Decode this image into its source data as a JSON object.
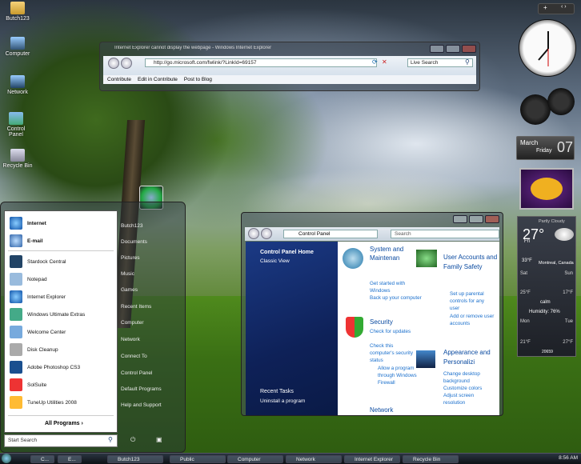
{
  "desktop_icons": [
    {
      "label": "Butch123"
    },
    {
      "label": "Computer"
    },
    {
      "label": "Network"
    },
    {
      "label": "Control Panel"
    },
    {
      "label": "Recycle Bin"
    }
  ],
  "ie": {
    "title": "Internet Explorer cannot display the webpage - Windows Internet Explorer",
    "address": "http://go.microsoft.com/fwlink/?LinkId=69157",
    "search_label": "Live Search",
    "toolbar": [
      "Contribute",
      "Edit in Contribute",
      "Post to Blog"
    ]
  },
  "start_menu": {
    "pinned": [
      "Internet",
      "E-mail"
    ],
    "recent": [
      "Stardock Central",
      "Notepad",
      "Internet Explorer",
      "Windows Ultimate Extras",
      "Welcome Center",
      "Disk Cleanup",
      "Adobe Photoshop CS3",
      "SolSuite",
      "TuneUp Utilities 2008"
    ],
    "all_programs": "All Programs",
    "search_placeholder": "Start Search",
    "right": [
      "Butch123",
      "Documents",
      "Pictures",
      "Music",
      "Games",
      "Recent Items",
      "Computer",
      "Network",
      "Connect To",
      "Control Panel",
      "Default Programs",
      "Help and Support"
    ]
  },
  "control_panel": {
    "breadcrumb": "Control Panel",
    "search": "Search",
    "nav_home": "Control Panel Home",
    "nav_classic": "Classic View",
    "recent_tasks": "Recent Tasks",
    "uninstall": "Uninstall a program",
    "categories": [
      {
        "title": "System and Maintenan",
        "links": [
          "Get started with Windows",
          "Back up your computer"
        ]
      },
      {
        "title": "Security",
        "links": [
          "Check for updates",
          "Check this computer's security status",
          "Allow a program through Windows Firewall"
        ]
      },
      {
        "title": "Network",
        "links": []
      },
      {
        "title": "User Accounts and Family Safety",
        "links": [
          "Set up parental controls for any user",
          "Add or remove user accounts"
        ]
      },
      {
        "title": "Appearance and Personalizi",
        "links": [
          "Change desktop background",
          "Customize colors",
          "Adjust screen resolution"
        ]
      }
    ]
  },
  "gadgets": {
    "month": "March",
    "day": "Friday",
    "date": "07",
    "weather": {
      "cond": "Partly Cloudy",
      "temp": "27°",
      "city": "Montreal, Canada",
      "low": "33°F",
      "calm": "calm",
      "humidity": "Humidity: 76%",
      "code": "20659",
      "forecast": [
        [
          "Sat",
          "Sun"
        ],
        [
          "25°F",
          "17°F"
        ],
        [
          "Mon",
          "Tue"
        ],
        [
          "21°F",
          "27°F"
        ]
      ],
      "today": "Fri"
    }
  },
  "taskbar": {
    "items": [
      "C...",
      "E...",
      "Butch123",
      "Public",
      "Computer",
      "Network",
      "Internet Explorer",
      "Recycle Bin"
    ],
    "time": "8:56 AM"
  }
}
